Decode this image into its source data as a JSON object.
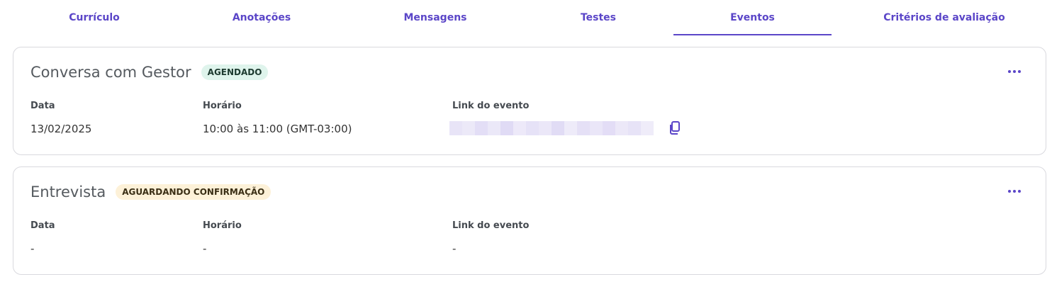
{
  "tabs": [
    {
      "label": "Currículo",
      "active": false
    },
    {
      "label": "Anotações",
      "active": false
    },
    {
      "label": "Mensagens",
      "active": false
    },
    {
      "label": "Testes",
      "active": false
    },
    {
      "label": "Eventos",
      "active": true
    },
    {
      "label": "Critérios de avaliação",
      "active": false
    }
  ],
  "colors": {
    "accent": "#5b46c8",
    "badge_scheduled_bg": "#dff4ec",
    "badge_pending_bg": "#fdf1d8"
  },
  "events": [
    {
      "title": "Conversa com Gestor",
      "status": "AGENDADO",
      "date_label": "Data",
      "date_value": "13/02/2025",
      "time_label": "Horário",
      "time_value": "10:00 às 11:00 (GMT-03:00)",
      "link_label": "Link do evento",
      "link_value": "",
      "link_blurred": true,
      "copy_icon": "copy-icon",
      "more_icon": "more-horizontal-icon"
    },
    {
      "title": "Entrevista",
      "status": "AGUARDANDO CONFIRMAÇÃO",
      "date_label": "Data",
      "date_value": "-",
      "time_label": "Horário",
      "time_value": "-",
      "link_label": "Link do evento",
      "link_value": "-",
      "more_icon": "more-horizontal-icon"
    }
  ]
}
